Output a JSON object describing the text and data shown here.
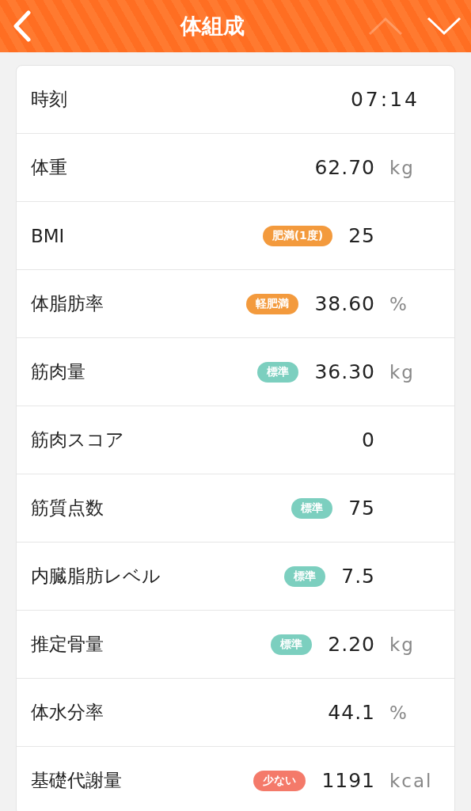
{
  "header": {
    "title": "体組成",
    "prev_disabled": true,
    "next_disabled": false
  },
  "rows": [
    {
      "kind": "time",
      "label": "時刻",
      "value": "07:14"
    },
    {
      "kind": "measure",
      "label": "体重",
      "value": "62.70",
      "unit": "kg"
    },
    {
      "kind": "measure",
      "label": "BMI",
      "badge": {
        "text": "肥満(1度)",
        "color": "#f39a3d"
      },
      "value": "25"
    },
    {
      "kind": "measure",
      "label": "体脂肪率",
      "badge": {
        "text": "軽肥満",
        "color": "#f39a3d"
      },
      "value": "38.60",
      "unit": "%"
    },
    {
      "kind": "measure",
      "label": "筋肉量",
      "badge": {
        "text": "標準",
        "color": "#7ccfbf"
      },
      "value": "36.30",
      "unit": "kg"
    },
    {
      "kind": "measure",
      "label": "筋肉スコア",
      "value": "0"
    },
    {
      "kind": "measure",
      "label": "筋質点数",
      "badge": {
        "text": "標準",
        "color": "#7ccfbf"
      },
      "value": "75"
    },
    {
      "kind": "measure",
      "label": "内臓脂肪レベル",
      "badge": {
        "text": "標準",
        "color": "#7ccfbf"
      },
      "value": "7.5"
    },
    {
      "kind": "measure",
      "label": "推定骨量",
      "badge": {
        "text": "標準",
        "color": "#7ccfbf"
      },
      "value": "2.20",
      "unit": "kg"
    },
    {
      "kind": "measure",
      "label": "体水分率",
      "value": "44.1",
      "unit": "%"
    },
    {
      "kind": "measure",
      "label": "基礎代謝量",
      "badge": {
        "text": "少ない",
        "color": "#f47a6a"
      },
      "value": "1191",
      "unit": "kcal"
    }
  ]
}
